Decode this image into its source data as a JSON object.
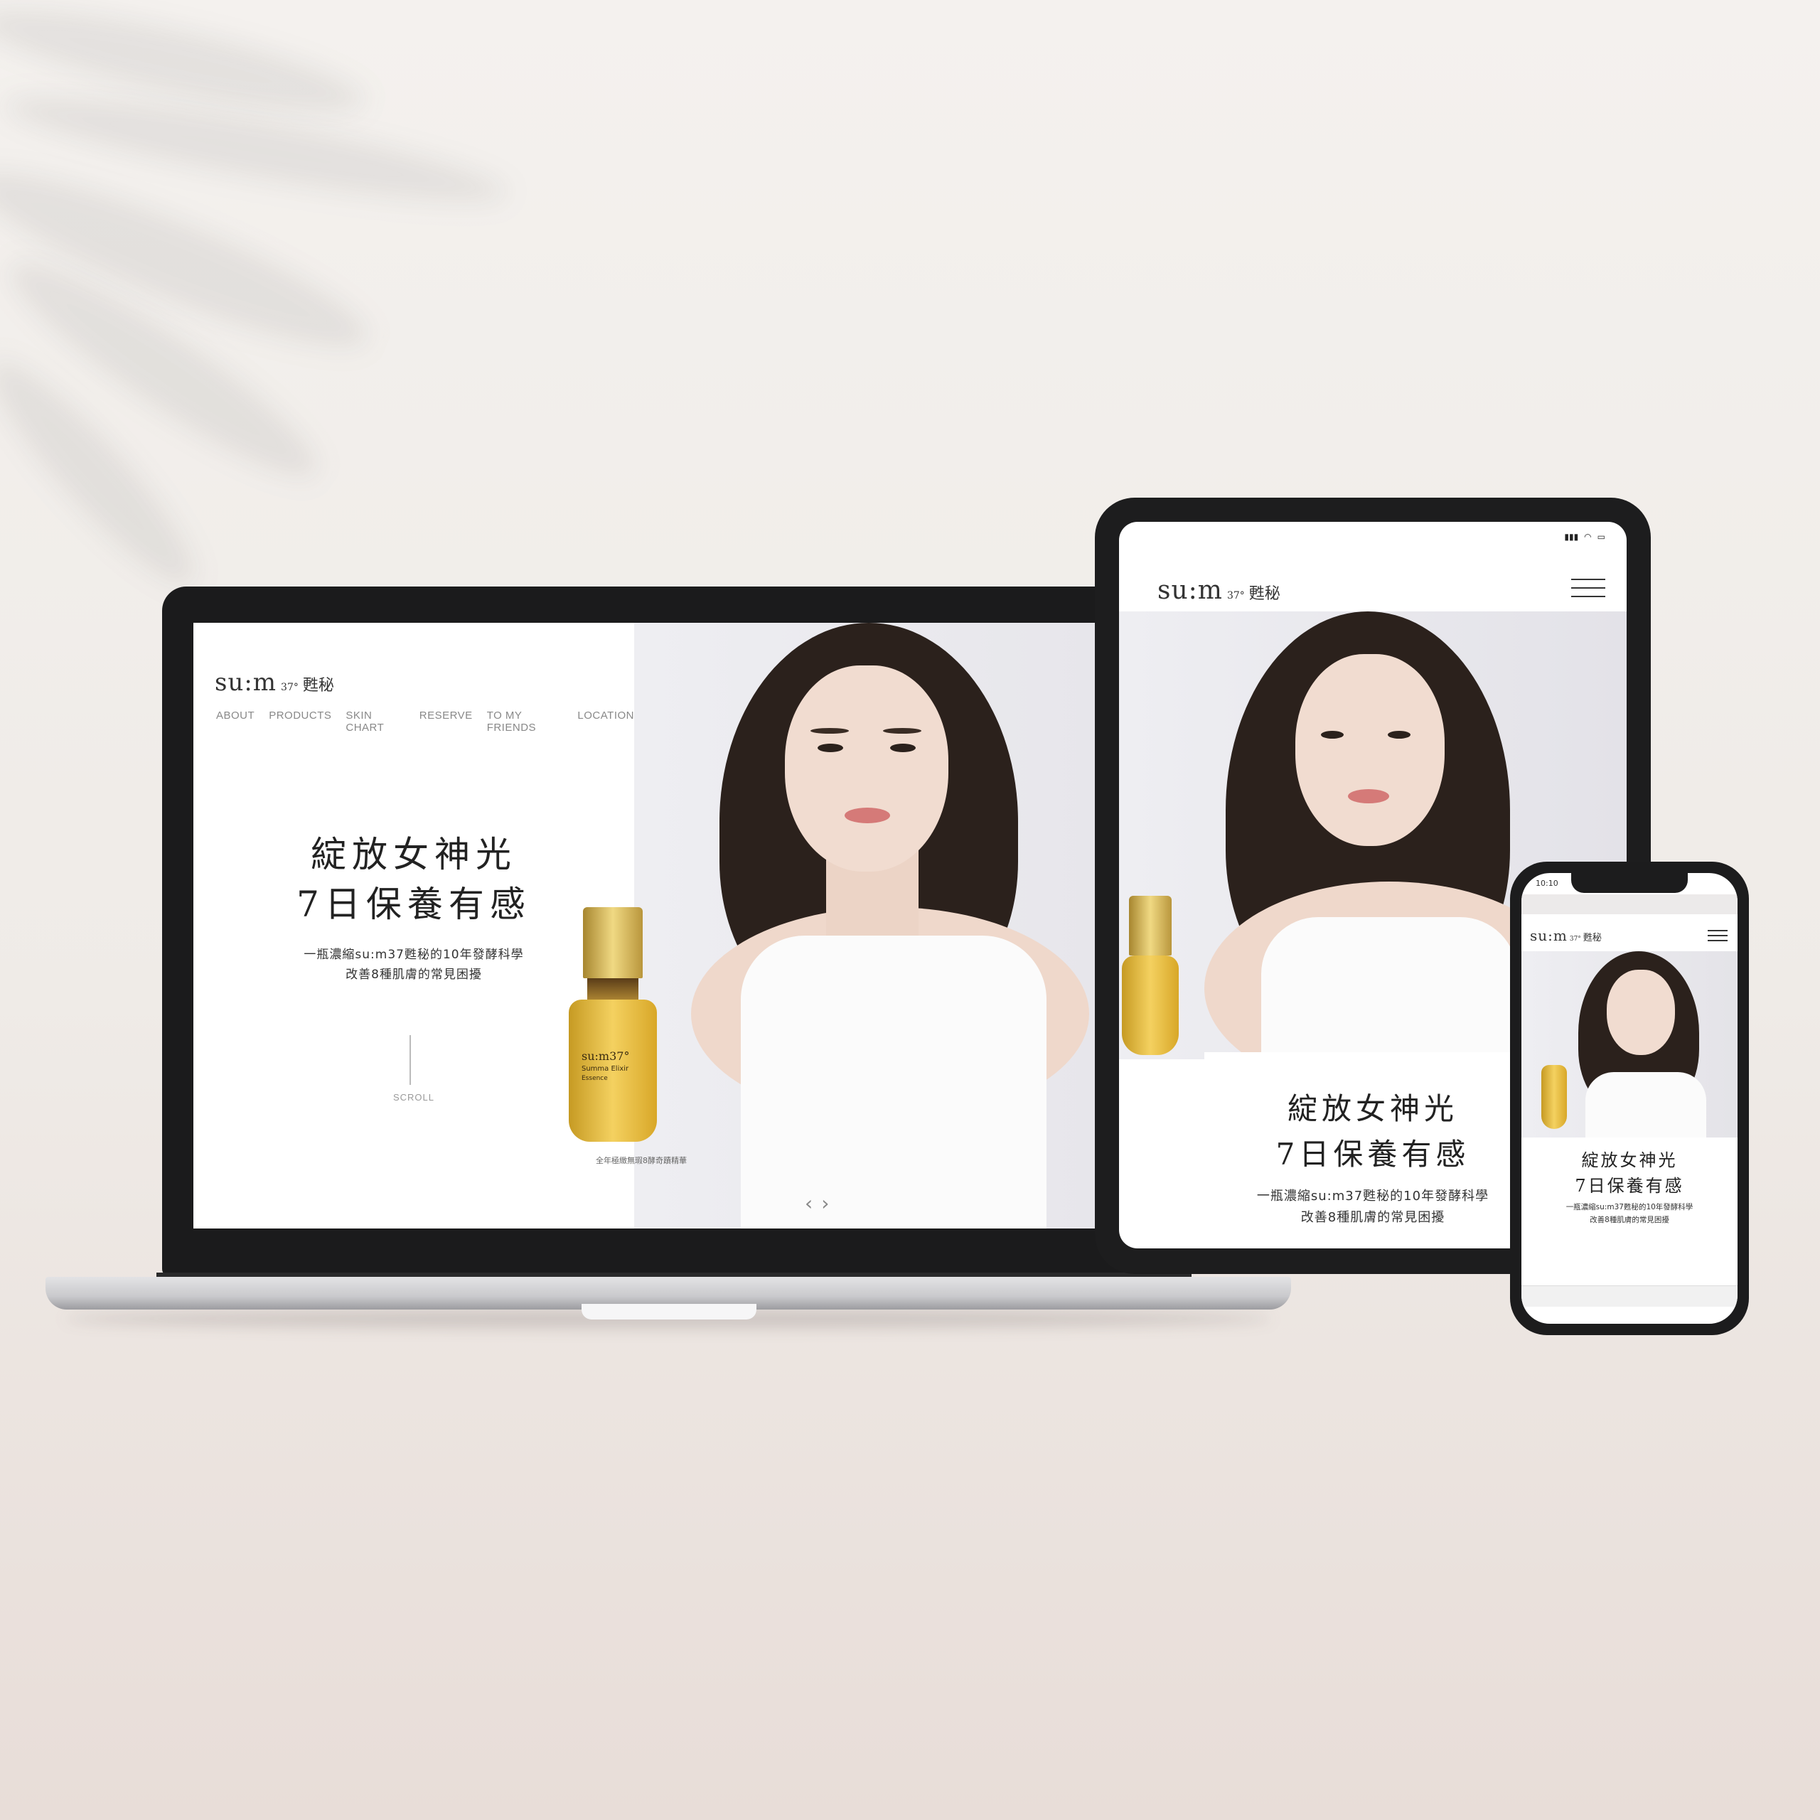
{
  "brand": {
    "logo": "su:m",
    "logo_mark": "37°",
    "logo_cn": "甦秘"
  },
  "nav": {
    "items": [
      "ABOUT",
      "PRODUCTS",
      "SKIN CHART",
      "RESERVE",
      "TO MY FRIENDS",
      "LOCATION"
    ]
  },
  "hero": {
    "title_line1": "綻放女神光",
    "title_line2": "7日保養有感",
    "subtitle_line1": "一瓶濃縮su:m37甦秘的10年發酵科學",
    "subtitle_line2": "改善8種肌膚的常見困擾",
    "scroll_label": "SCROLL",
    "product_caption": "全年極緻無瑕8酵奇蹟精華"
  },
  "bottle": {
    "brand": "su:m37°",
    "name": "Summa Elixir",
    "type": "Essence"
  },
  "tablet": {
    "subtitle_line1": "一瓶濃縮su:m37甦秘的10年發酵科學"
  },
  "phone": {
    "time": "10:10"
  },
  "carousel": {
    "prev_icon": "‹",
    "next_icon": "›"
  },
  "colors": {
    "background": "#f2eeeb",
    "gold": "#d4bd7e",
    "text_dark": "#222222",
    "nav_gray": "#888888"
  }
}
